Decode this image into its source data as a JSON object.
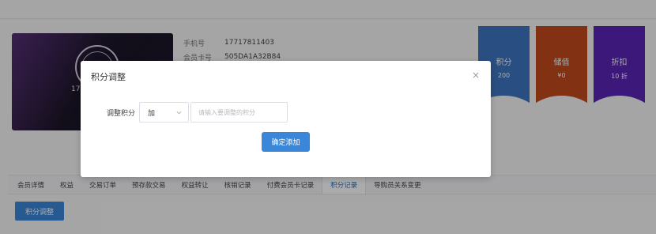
{
  "member": {
    "phone_label": "手机号",
    "phone_value": "17717811403",
    "card_label": "会员卡号",
    "card_value": "505DA1A32B84",
    "card_number_partial": "17"
  },
  "stats": [
    {
      "label": "积分",
      "value": "200",
      "color": "#3e77c2"
    },
    {
      "label": "储值",
      "value": "¥0",
      "color": "#c24a1d"
    },
    {
      "label": "折扣",
      "value": "10 折",
      "color": "#5a24b8"
    }
  ],
  "tabs": [
    "会员详情",
    "权益",
    "交易订单",
    "预存款交易",
    "权益转让",
    "核销记录",
    "付费会员卡记录",
    "积分记录",
    "导购员关系变更"
  ],
  "active_tab_index": 7,
  "adjust_button": "积分调整",
  "modal": {
    "title": "积分调整",
    "close_symbol": "×",
    "field_label": "调整积分",
    "select_value": "加",
    "input_placeholder": "请输入要调整的积分",
    "confirm_label": "确定添加"
  }
}
